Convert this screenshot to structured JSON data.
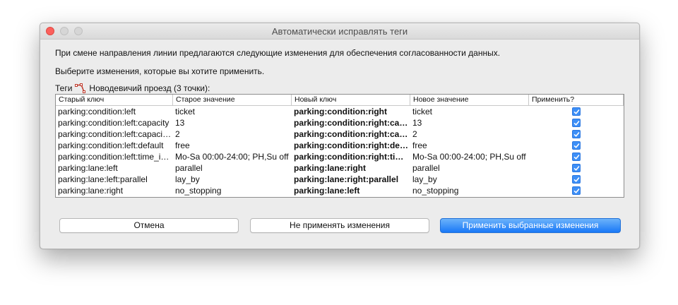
{
  "window": {
    "title": "Автоматически исправлять теги"
  },
  "message": {
    "line1": "При смене направления линии предлагаются следующие изменения для обеспечения согласованности данных.",
    "line2": "Выберите изменения, которые вы хотите применить."
  },
  "tags_header": {
    "prefix": "Теги",
    "object": "Новодевичий проезд (3 точки):",
    "icon": "way-icon"
  },
  "table": {
    "columns": [
      "Старый ключ",
      "Старое значение",
      "Новый ключ",
      "Новое значение",
      "Применить?"
    ],
    "rows": [
      {
        "old_key": "parking:condition:left",
        "old_value": "ticket",
        "new_key": "parking:condition:right",
        "new_value": "ticket",
        "apply": true
      },
      {
        "old_key": "parking:condition:left:capacity",
        "old_value": "13",
        "new_key": "parking:condition:right:capacity",
        "new_value": "13",
        "apply": true
      },
      {
        "old_key": "parking:condition:left:capacity:disabled",
        "old_value": "2",
        "new_key": "parking:condition:right:capacity:disabled",
        "new_value": "2",
        "apply": true
      },
      {
        "old_key": "parking:condition:left:default",
        "old_value": "free",
        "new_key": "parking:condition:right:default",
        "new_value": "free",
        "apply": true
      },
      {
        "old_key": "parking:condition:left:time_interval",
        "old_value": "Mo-Sa 00:00-24:00; PH,Su off",
        "new_key": "parking:condition:right:time_interval",
        "new_value": "Mo-Sa 00:00-24:00; PH,Su off",
        "apply": true
      },
      {
        "old_key": "parking:lane:left",
        "old_value": "parallel",
        "new_key": "parking:lane:right",
        "new_value": "parallel",
        "apply": true
      },
      {
        "old_key": "parking:lane:left:parallel",
        "old_value": "lay_by",
        "new_key": "parking:lane:right:parallel",
        "new_value": "lay_by",
        "apply": true
      },
      {
        "old_key": "parking:lane:right",
        "old_value": "no_stopping",
        "new_key": "parking:lane:left",
        "new_value": "no_stopping",
        "apply": true
      }
    ]
  },
  "buttons": {
    "cancel": "Отмена",
    "dont_apply": "Не применять изменения",
    "apply": "Применить выбранные изменения"
  },
  "colors": {
    "accent": "#1978f7",
    "checkbox": "#3d8ff7",
    "close": "#fc605c"
  }
}
